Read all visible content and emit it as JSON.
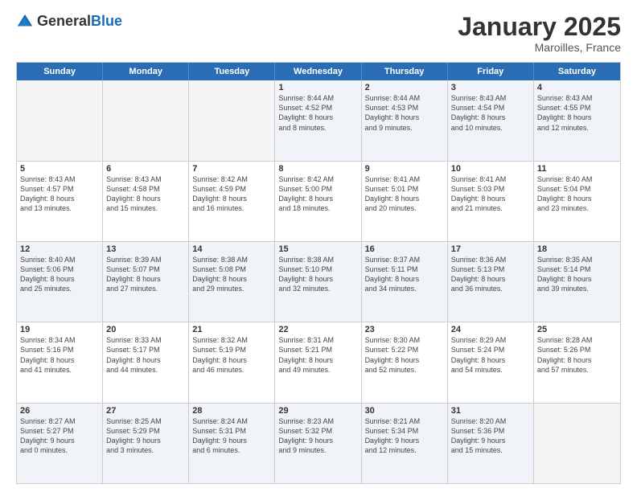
{
  "header": {
    "logo_general": "General",
    "logo_blue": "Blue",
    "month": "January 2025",
    "location": "Maroilles, France"
  },
  "weekdays": [
    "Sunday",
    "Monday",
    "Tuesday",
    "Wednesday",
    "Thursday",
    "Friday",
    "Saturday"
  ],
  "rows": [
    [
      {
        "day": "",
        "detail": "",
        "empty": true
      },
      {
        "day": "",
        "detail": "",
        "empty": true
      },
      {
        "day": "",
        "detail": "",
        "empty": true
      },
      {
        "day": "1",
        "detail": "Sunrise: 8:44 AM\nSunset: 4:52 PM\nDaylight: 8 hours\nand 8 minutes."
      },
      {
        "day": "2",
        "detail": "Sunrise: 8:44 AM\nSunset: 4:53 PM\nDaylight: 8 hours\nand 9 minutes."
      },
      {
        "day": "3",
        "detail": "Sunrise: 8:43 AM\nSunset: 4:54 PM\nDaylight: 8 hours\nand 10 minutes."
      },
      {
        "day": "4",
        "detail": "Sunrise: 8:43 AM\nSunset: 4:55 PM\nDaylight: 8 hours\nand 12 minutes."
      }
    ],
    [
      {
        "day": "5",
        "detail": "Sunrise: 8:43 AM\nSunset: 4:57 PM\nDaylight: 8 hours\nand 13 minutes."
      },
      {
        "day": "6",
        "detail": "Sunrise: 8:43 AM\nSunset: 4:58 PM\nDaylight: 8 hours\nand 15 minutes."
      },
      {
        "day": "7",
        "detail": "Sunrise: 8:42 AM\nSunset: 4:59 PM\nDaylight: 8 hours\nand 16 minutes."
      },
      {
        "day": "8",
        "detail": "Sunrise: 8:42 AM\nSunset: 5:00 PM\nDaylight: 8 hours\nand 18 minutes."
      },
      {
        "day": "9",
        "detail": "Sunrise: 8:41 AM\nSunset: 5:01 PM\nDaylight: 8 hours\nand 20 minutes."
      },
      {
        "day": "10",
        "detail": "Sunrise: 8:41 AM\nSunset: 5:03 PM\nDaylight: 8 hours\nand 21 minutes."
      },
      {
        "day": "11",
        "detail": "Sunrise: 8:40 AM\nSunset: 5:04 PM\nDaylight: 8 hours\nand 23 minutes."
      }
    ],
    [
      {
        "day": "12",
        "detail": "Sunrise: 8:40 AM\nSunset: 5:06 PM\nDaylight: 8 hours\nand 25 minutes."
      },
      {
        "day": "13",
        "detail": "Sunrise: 8:39 AM\nSunset: 5:07 PM\nDaylight: 8 hours\nand 27 minutes."
      },
      {
        "day": "14",
        "detail": "Sunrise: 8:38 AM\nSunset: 5:08 PM\nDaylight: 8 hours\nand 29 minutes."
      },
      {
        "day": "15",
        "detail": "Sunrise: 8:38 AM\nSunset: 5:10 PM\nDaylight: 8 hours\nand 32 minutes."
      },
      {
        "day": "16",
        "detail": "Sunrise: 8:37 AM\nSunset: 5:11 PM\nDaylight: 8 hours\nand 34 minutes."
      },
      {
        "day": "17",
        "detail": "Sunrise: 8:36 AM\nSunset: 5:13 PM\nDaylight: 8 hours\nand 36 minutes."
      },
      {
        "day": "18",
        "detail": "Sunrise: 8:35 AM\nSunset: 5:14 PM\nDaylight: 8 hours\nand 39 minutes."
      }
    ],
    [
      {
        "day": "19",
        "detail": "Sunrise: 8:34 AM\nSunset: 5:16 PM\nDaylight: 8 hours\nand 41 minutes."
      },
      {
        "day": "20",
        "detail": "Sunrise: 8:33 AM\nSunset: 5:17 PM\nDaylight: 8 hours\nand 44 minutes."
      },
      {
        "day": "21",
        "detail": "Sunrise: 8:32 AM\nSunset: 5:19 PM\nDaylight: 8 hours\nand 46 minutes."
      },
      {
        "day": "22",
        "detail": "Sunrise: 8:31 AM\nSunset: 5:21 PM\nDaylight: 8 hours\nand 49 minutes."
      },
      {
        "day": "23",
        "detail": "Sunrise: 8:30 AM\nSunset: 5:22 PM\nDaylight: 8 hours\nand 52 minutes."
      },
      {
        "day": "24",
        "detail": "Sunrise: 8:29 AM\nSunset: 5:24 PM\nDaylight: 8 hours\nand 54 minutes."
      },
      {
        "day": "25",
        "detail": "Sunrise: 8:28 AM\nSunset: 5:26 PM\nDaylight: 8 hours\nand 57 minutes."
      }
    ],
    [
      {
        "day": "26",
        "detail": "Sunrise: 8:27 AM\nSunset: 5:27 PM\nDaylight: 9 hours\nand 0 minutes."
      },
      {
        "day": "27",
        "detail": "Sunrise: 8:25 AM\nSunset: 5:29 PM\nDaylight: 9 hours\nand 3 minutes."
      },
      {
        "day": "28",
        "detail": "Sunrise: 8:24 AM\nSunset: 5:31 PM\nDaylight: 9 hours\nand 6 minutes."
      },
      {
        "day": "29",
        "detail": "Sunrise: 8:23 AM\nSunset: 5:32 PM\nDaylight: 9 hours\nand 9 minutes."
      },
      {
        "day": "30",
        "detail": "Sunrise: 8:21 AM\nSunset: 5:34 PM\nDaylight: 9 hours\nand 12 minutes."
      },
      {
        "day": "31",
        "detail": "Sunrise: 8:20 AM\nSunset: 5:36 PM\nDaylight: 9 hours\nand 15 minutes."
      },
      {
        "day": "",
        "detail": "",
        "empty": true
      }
    ]
  ]
}
